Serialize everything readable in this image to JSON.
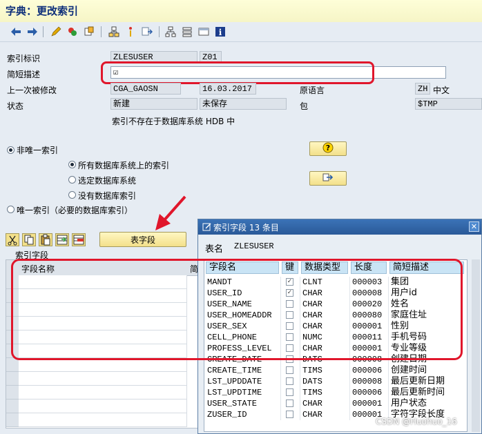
{
  "window": {
    "title": "字典：更改索引"
  },
  "toolbar": {
    "icons": [
      "arrow-left",
      "arrow-right",
      "edit-pen",
      "activate",
      "object-check",
      "hierarchy",
      "display-mode",
      "sub-object",
      "tree",
      "stack",
      "window",
      "info"
    ]
  },
  "form": {
    "index_id_label": "索引标识",
    "index_name": "ZLESUSER",
    "index_suffix": "Z01",
    "short_desc_label": "简短描述",
    "short_desc_value": "☑",
    "last_changed_label": "上一次被修改",
    "last_changed_user": "CGA_GAOSN",
    "last_changed_date": "16.03.2017",
    "orig_lang_label": "原语言",
    "orig_lang_code": "ZH",
    "orig_lang_name": "中文",
    "status_label": "状态",
    "status_value1": "新建",
    "status_value2": "未保存",
    "package_label": "包",
    "package_value": "$TMP",
    "db_note": "索引不存在于数据库系统 HDB 中"
  },
  "options": {
    "non_unique": "非唯一索引",
    "all_db": "所有数据库系统上的索引",
    "selected_db": "选定数据库系统",
    "no_db": "没有数据库索引",
    "unique": "唯一索引（必要的数据库索引）"
  },
  "buttons": {
    "table_fields": "表字段"
  },
  "index_fields": {
    "section_label": "索引字段",
    "col_field_name": "字段名称",
    "col_short": "简"
  },
  "popup": {
    "title": "索引字段 13 条目",
    "table_label": "表名",
    "table_value": "ZLESUSER",
    "headers": {
      "field": "字段名",
      "key": "键",
      "dtype": "数据类型",
      "length": "长度",
      "desc": "简短描述"
    },
    "rows": [
      {
        "field": "MANDT",
        "key": true,
        "dtype": "CLNT",
        "length": "000003",
        "desc": "集团"
      },
      {
        "field": "USER_ID",
        "key": true,
        "dtype": "CHAR",
        "length": "000008",
        "desc": "用户id"
      },
      {
        "field": "USER_NAME",
        "key": false,
        "dtype": "CHAR",
        "length": "000020",
        "desc": "姓名"
      },
      {
        "field": "USER_HOMEADDR",
        "key": false,
        "dtype": "CHAR",
        "length": "000080",
        "desc": "家庭住址"
      },
      {
        "field": "USER_SEX",
        "key": false,
        "dtype": "CHAR",
        "length": "000001",
        "desc": "性别"
      },
      {
        "field": "CELL_PHONE",
        "key": false,
        "dtype": "NUMC",
        "length": "000011",
        "desc": "手机号码"
      },
      {
        "field": "PROFESS_LEVEL",
        "key": false,
        "dtype": "CHAR",
        "length": "000001",
        "desc": "专业等级"
      },
      {
        "field": "CREATE_DATE",
        "key": false,
        "dtype": "DATS",
        "length": "000008",
        "desc": "创建日期"
      },
      {
        "field": "CREATE_TIME",
        "key": false,
        "dtype": "TIMS",
        "length": "000006",
        "desc": "创建时间"
      },
      {
        "field": "LST_UPDDATE",
        "key": false,
        "dtype": "DATS",
        "length": "000008",
        "desc": "最后更新日期"
      },
      {
        "field": "LST_UPDTIME",
        "key": false,
        "dtype": "TIMS",
        "length": "000006",
        "desc": "最后更新时间"
      },
      {
        "field": "USER_STATE",
        "key": false,
        "dtype": "CHAR",
        "length": "000001",
        "desc": "用户状态"
      },
      {
        "field": "ZUSER_ID",
        "key": false,
        "dtype": "CHAR",
        "length": "000001",
        "desc": "字符字段长度"
      }
    ]
  },
  "watermark": "CSDN @Huohuo_16"
}
